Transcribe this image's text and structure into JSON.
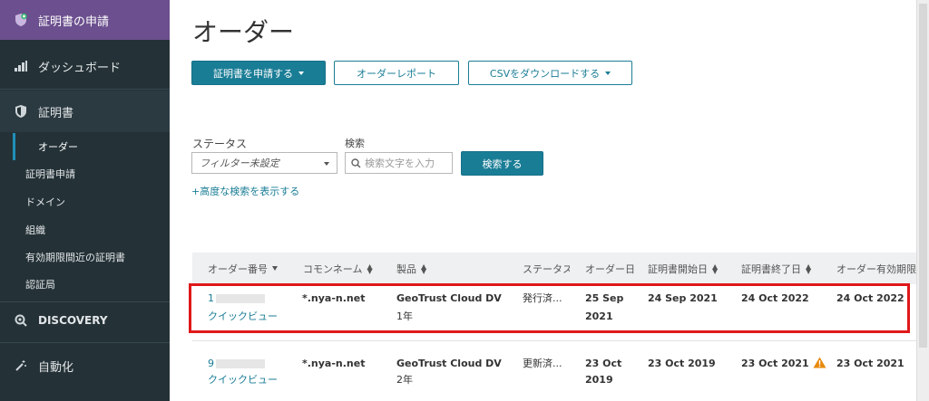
{
  "sidebar": {
    "request": "証明書の申請",
    "dashboard": "ダッシュボード",
    "certificates": "証明書",
    "sub": [
      "オーダー",
      "証明書申請",
      "ドメイン",
      "組織",
      "有効期限間近の証明書",
      "認証局"
    ],
    "discovery": "DISCOVERY",
    "automation": "自動化"
  },
  "page": {
    "title": "オーダー"
  },
  "toolbar": {
    "request_cert": "証明書を申請する",
    "order_report": "オーダーレポート",
    "download_csv": "CSVをダウンロードする"
  },
  "filters": {
    "status_label": "ステータス",
    "status_value": "フィルター未設定",
    "search_label": "検索",
    "search_placeholder": "検索文字を入力",
    "search_button": "検索する",
    "advanced_link": "+高度な検索を表示する"
  },
  "table": {
    "headers": [
      "オーダー番号",
      "コモンネーム",
      "製品",
      "ステータス",
      "オーダー日",
      "証明書開始日",
      "証明書終了日",
      "オーダー有効期限"
    ],
    "rows": [
      {
        "order_no": "1",
        "quick_view": "クイックビュー",
        "common_name": "*.nya-n.net",
        "product": "GeoTrust Cloud DV",
        "product_term": "1年",
        "status": "発行済...",
        "order_date_1": "25 Sep",
        "order_date_2": "2021",
        "start": "24 Sep 2021",
        "end": "24 Oct 2022",
        "expiry": "24 Oct 2022"
      },
      {
        "order_no": "9",
        "quick_view": "クイックビュー",
        "common_name": "*.nya-n.net",
        "product": "GeoTrust Cloud DV",
        "product_term": "2年",
        "status": "更新済...",
        "order_date_1": "23 Oct",
        "order_date_2": "2019",
        "start": "23 Oct 2019",
        "end": "23 Oct 2021",
        "expiry": "23 Oct 2021"
      }
    ]
  },
  "colors": {
    "sidebar_bg": "#243237",
    "request_bg": "#6b4f8e",
    "accent": "#1a7d96",
    "highlight": "#e0181a",
    "warning": "#e8890c"
  }
}
